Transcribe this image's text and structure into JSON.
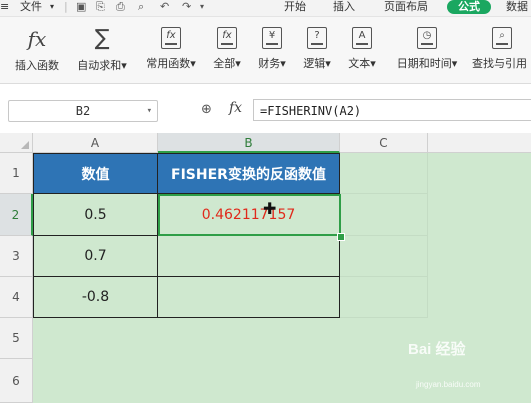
{
  "menubar": {
    "file_label": "文件",
    "tabs": [
      "开始",
      "插入",
      "页面布局",
      "公式",
      "数据"
    ],
    "active_tab": "公式"
  },
  "ribbon": {
    "buttons": [
      {
        "label": "插入函数",
        "icon": "fx-icon"
      },
      {
        "label": "自动求和▾",
        "icon": "sigma-icon"
      },
      {
        "label": "常用函数▾",
        "icon": "star-fx-icon"
      },
      {
        "label": "全部▾",
        "icon": "fx-book-icon"
      },
      {
        "label": "财务▾",
        "icon": "yen-book-icon"
      },
      {
        "label": "逻辑▾",
        "icon": "question-book-icon"
      },
      {
        "label": "文本▾",
        "icon": "text-book-icon"
      },
      {
        "label": "日期和时间▾",
        "icon": "clock-book-icon"
      },
      {
        "label": "查找与引用",
        "icon": "search-book-icon"
      }
    ],
    "glyphs": {
      "fx": "fx",
      "sigma": "∑",
      "star_fx": "fx",
      "all": "fx",
      "yen": "¥",
      "q": "?",
      "text": "A"
    }
  },
  "formula_bar": {
    "name_box": "B2",
    "fx_label": "fx",
    "formula": "=FISHERINV(A2)"
  },
  "sheet": {
    "columns": [
      "A",
      "B",
      "C"
    ],
    "rows": [
      "1",
      "2",
      "3",
      "4",
      "5",
      "6"
    ],
    "header": {
      "a": "数值",
      "b": "FISHER变换的反函数值"
    },
    "data": [
      {
        "a": "0.5",
        "b": "0.462117157"
      },
      {
        "a": "0.7",
        "b": ""
      },
      {
        "a": "-0.8",
        "b": ""
      }
    ],
    "selected_cell": "B2",
    "result_color": "#e0291b",
    "header_color": "#2e74b5",
    "background_color": "#cfe8cf"
  },
  "watermark": {
    "text": "Bai 经验",
    "sub": "jingyan.baidu.com"
  }
}
